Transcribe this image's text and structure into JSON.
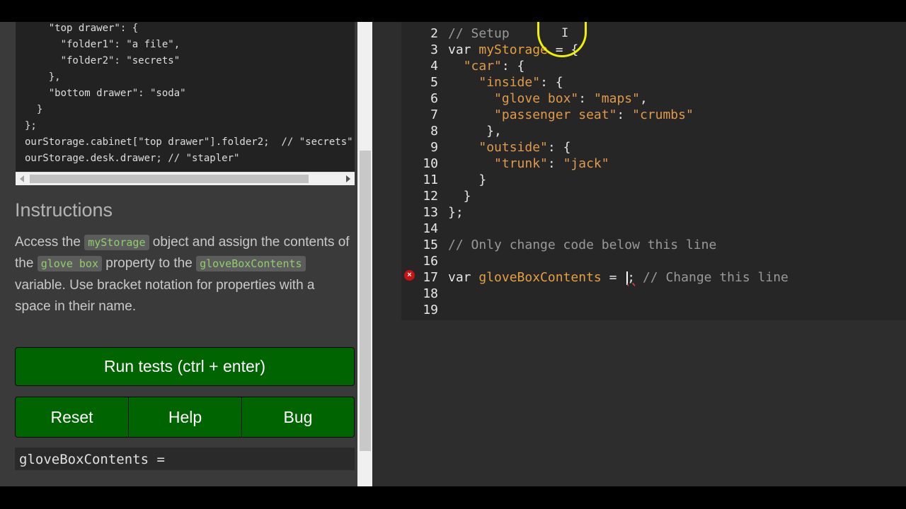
{
  "example": {
    "code": "    \"top drawer\": {\n      \"folder1\": \"a file\",\n      \"folder2\": \"secrets\"\n    },\n    \"bottom drawer\": \"soda\"\n  }\n};\nourStorage.cabinet[\"top drawer\"].folder2;  // \"secrets\"\nourStorage.desk.drawer; // \"stapler\""
  },
  "instructions": {
    "title": "Instructions",
    "p1": "Access the ",
    "code1": "myStorage",
    "p2": " object and assign the contents of the ",
    "code2": "glove box",
    "p3": " property to the ",
    "code3": "gloveBoxContents",
    "p4": " variable. Use bracket notation for properties with a space in their name."
  },
  "buttons": {
    "run": "Run tests (ctrl + enter)",
    "reset": "Reset",
    "help": "Help",
    "bug": "Bug"
  },
  "output": {
    "text": "gloveBoxContents ="
  },
  "editor": {
    "line_numbers": [
      "2",
      "3",
      "4",
      "5",
      "6",
      "7",
      "8",
      "9",
      "10",
      "11",
      "12",
      "13",
      "14",
      "15",
      "16",
      "17",
      "18",
      "19"
    ],
    "l2": "// Setup",
    "l3a": "var",
    "l3b": "myStorage",
    "l3c": " = {",
    "l4a": "  ",
    "l4b": "\"car\"",
    "l4c": ": {",
    "l5a": "    ",
    "l5b": "\"inside\"",
    "l5c": ": {",
    "l6a": "      ",
    "l6b": "\"glove box\"",
    "l6c": ": ",
    "l6d": "\"maps\"",
    "l6e": ",",
    "l7a": "      ",
    "l7b": "\"passenger seat\"",
    "l7c": ": ",
    "l7d": "\"crumbs\"",
    "l8": "     },",
    "l9a": "    ",
    "l9b": "\"outside\"",
    "l9c": ": {",
    "l10a": "      ",
    "l10b": "\"trunk\"",
    "l10c": ": ",
    "l10d": "\"jack\"",
    "l11": "    }",
    "l12": "  }",
    "l13": "};",
    "l15": "// Only change code below this line",
    "l17a": "var",
    "l17b": "gloveBoxContents",
    "l17c": " =",
    "l17d": ";",
    "l17e": " // Change this line"
  },
  "icons": {
    "error": "error-icon",
    "cursor": "text-cursor-icon"
  }
}
